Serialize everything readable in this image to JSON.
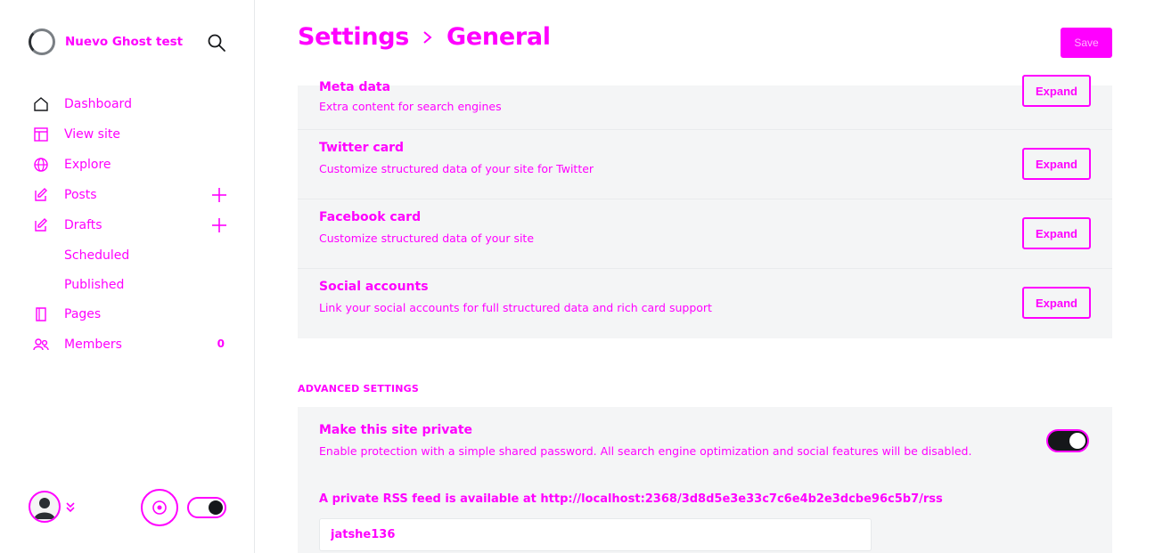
{
  "brand": {
    "name": "Nuevo Ghost test"
  },
  "sidebar": {
    "items": [
      {
        "label": "Dashboard",
        "icon": "home-icon"
      },
      {
        "label": "View site",
        "icon": "browser-icon"
      },
      {
        "label": "Explore",
        "icon": "globe-icon"
      },
      {
        "label": "Posts",
        "icon": "pencil-icon"
      },
      {
        "label": "Drafts",
        "icon": "pencil-icon"
      },
      {
        "label": "Pages",
        "icon": "pages-icon"
      },
      {
        "label": "Members",
        "icon": "members-icon",
        "count": "0"
      }
    ],
    "sub_items": [
      "Scheduled",
      "Published"
    ]
  },
  "header": {
    "crumb_root": "Settings",
    "crumb_current": "General",
    "save_label": "Save"
  },
  "meta_rows": [
    {
      "title": "Meta data",
      "desc": "Extra content for search engines",
      "button": "Expand"
    },
    {
      "title": "Twitter card",
      "desc": "Customize structured data of your site for Twitter",
      "button": "Expand"
    },
    {
      "title": "Facebook card",
      "desc": "Customize structured data of your site",
      "button": "Expand"
    },
    {
      "title": "Social accounts",
      "desc": "Link your social accounts for full structured data and rich card support",
      "button": "Expand"
    }
  ],
  "advanced": {
    "section_label": "ADVANCED SETTINGS",
    "private_title": "Make this site private",
    "private_desc": "Enable protection with a simple shared password. All search engine optimization and social features will be disabled.",
    "private_enabled": true,
    "rss_prefix": "A private RSS feed is available at",
    "rss_url": "http://localhost:2368/3d8d5e3e33c7c6e4b2e3dcbe96c5b7/rss",
    "password_value": "jatshe136"
  },
  "colors": {
    "accent": "#ff00ff",
    "card_bg": "#f4f5f6",
    "dark": "#15171a"
  }
}
